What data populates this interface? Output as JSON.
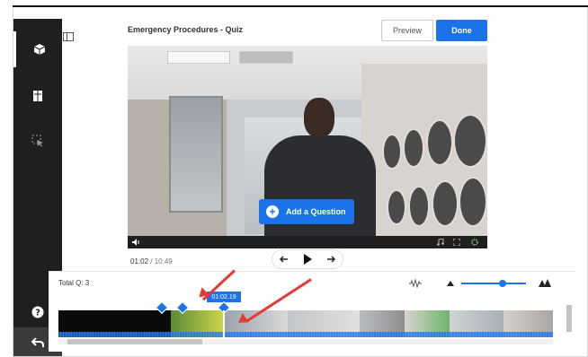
{
  "app": {
    "title": "Emergency Procedures - Quiz",
    "preview_label": "Preview",
    "done_label": "Done"
  },
  "video": {
    "add_question_label": "Add a Question",
    "current_time": "01:02",
    "duration": "10:49",
    "time_separator": "/"
  },
  "timeline": {
    "total_questions": "Total Q: 3",
    "marker_time": "01:02.19"
  },
  "colors": {
    "accent": "#1a73e8",
    "sidebar_bg": "#1f1f1f",
    "annotation_arrow": "#e53935"
  }
}
